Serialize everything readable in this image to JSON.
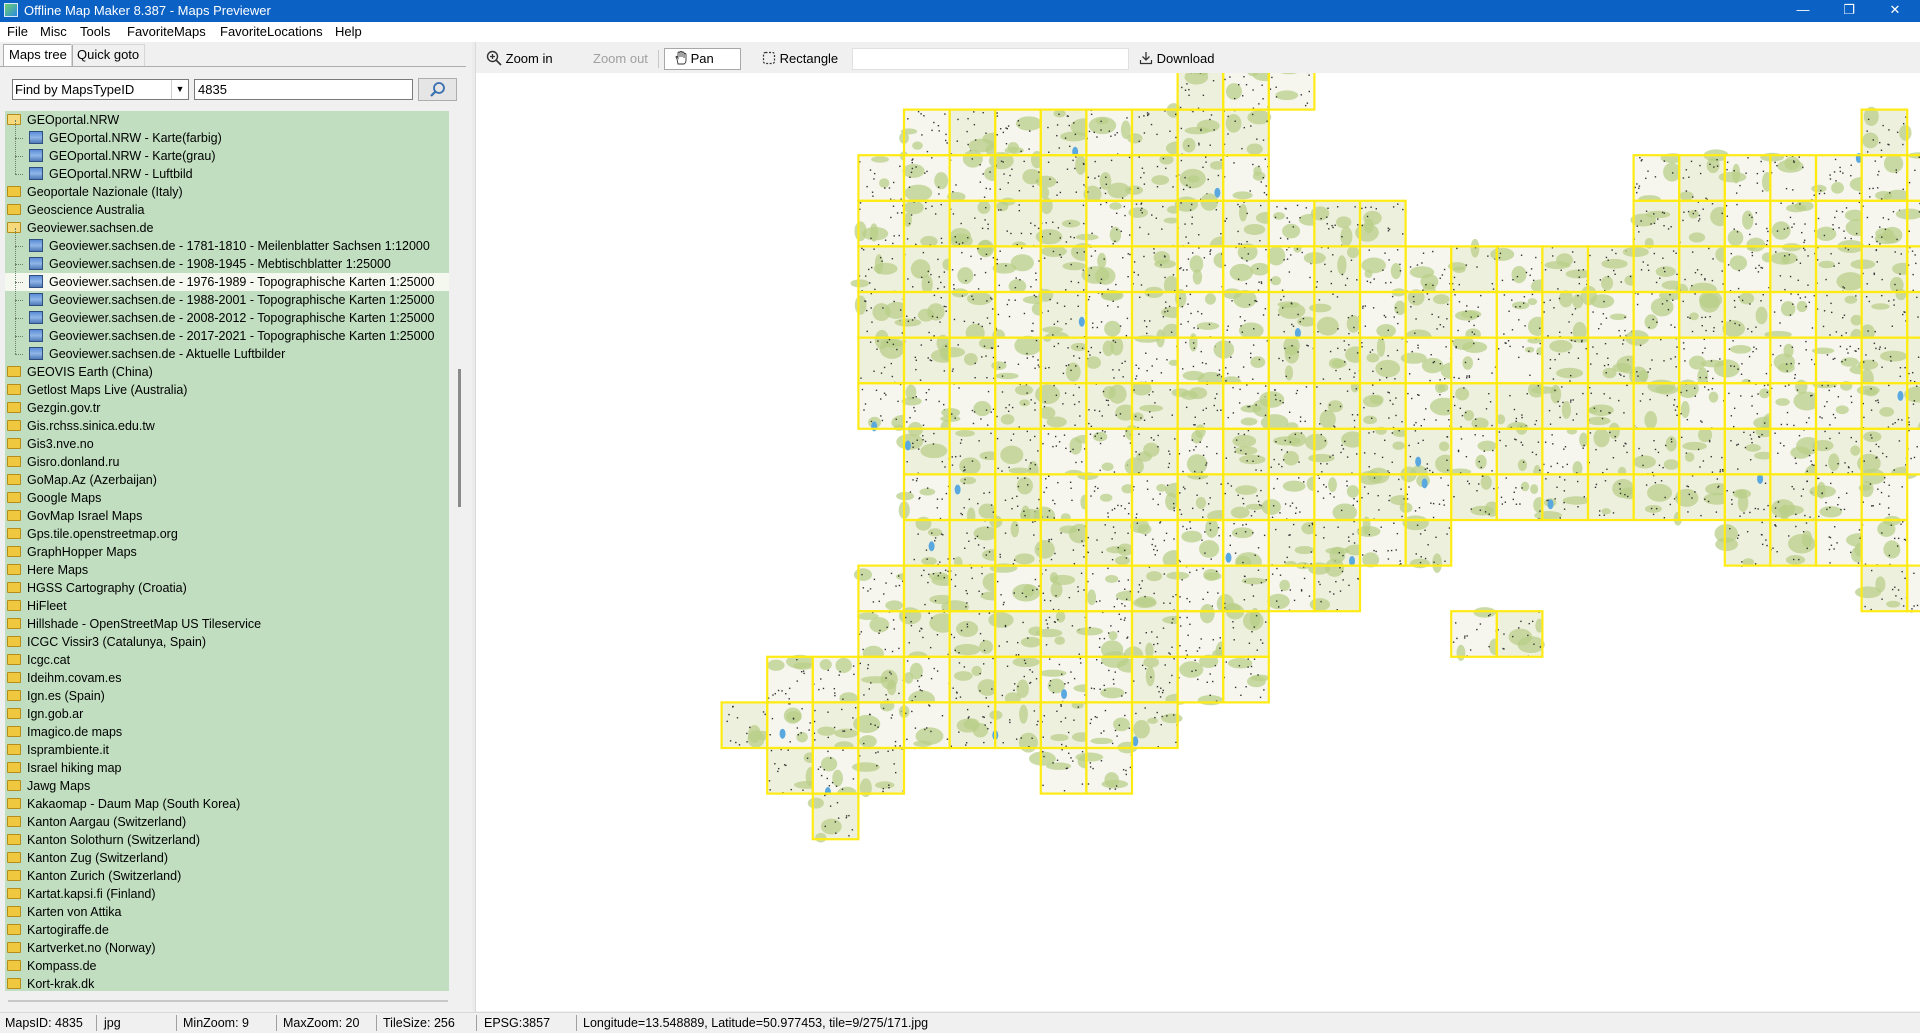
{
  "window": {
    "title": "Offline Map Maker 8.387 - Maps Previewer",
    "minimize": "—",
    "maximize": "❐",
    "close": "✕"
  },
  "menu": [
    "File",
    "Misc",
    "Tools",
    "FavoriteMaps",
    "FavoriteLocations",
    "Help"
  ],
  "tabs": {
    "maps_tree": "Maps tree",
    "quick_goto": "Quick goto"
  },
  "search": {
    "mode": "Find by MapsTypeID",
    "value": "4835"
  },
  "tree": [
    {
      "label": "GEOportal.NRW",
      "type": "folder-open",
      "depth": 0
    },
    {
      "label": "GEOportal.NRW - Karte(farbig)",
      "type": "map",
      "depth": 1
    },
    {
      "label": "GEOportal.NRW - Karte(grau)",
      "type": "map",
      "depth": 1
    },
    {
      "label": "GEOportal.NRW - Luftbild",
      "type": "map",
      "depth": 1
    },
    {
      "label": "Geoportale Nazionale (Italy)",
      "type": "folder",
      "depth": 0
    },
    {
      "label": "Geoscience Australia",
      "type": "folder",
      "depth": 0
    },
    {
      "label": "Geoviewer.sachsen.de",
      "type": "folder-open",
      "depth": 0
    },
    {
      "label": "Geoviewer.sachsen.de - 1781-1810 - Meilenblatter Sachsen 1:12000",
      "type": "map",
      "depth": 1
    },
    {
      "label": "Geoviewer.sachsen.de - 1908-1945 - Mebtischblatter 1:25000",
      "type": "map",
      "depth": 1
    },
    {
      "label": "Geoviewer.sachsen.de - 1976-1989 - Topographische Karten 1:25000",
      "type": "map",
      "depth": 1,
      "selected": true
    },
    {
      "label": "Geoviewer.sachsen.de - 1988-2001 - Topographische Karten 1:25000",
      "type": "map",
      "depth": 1
    },
    {
      "label": "Geoviewer.sachsen.de - 2008-2012 - Topographische Karten 1:25000",
      "type": "map",
      "depth": 1
    },
    {
      "label": "Geoviewer.sachsen.de - 2017-2021 - Topographische Karten 1:25000",
      "type": "map",
      "depth": 1
    },
    {
      "label": "Geoviewer.sachsen.de - Aktuelle Luftbilder",
      "type": "map",
      "depth": 1
    },
    {
      "label": "GEOVIS Earth (China)",
      "type": "folder",
      "depth": 0
    },
    {
      "label": "Getlost Maps Live (Australia)",
      "type": "folder",
      "depth": 0
    },
    {
      "label": "Gezgin.gov.tr",
      "type": "folder",
      "depth": 0
    },
    {
      "label": "Gis.rchss.sinica.edu.tw",
      "type": "folder",
      "depth": 0
    },
    {
      "label": "Gis3.nve.no",
      "type": "folder",
      "depth": 0
    },
    {
      "label": "Gisro.donland.ru",
      "type": "folder",
      "depth": 0
    },
    {
      "label": "GoMap.Az (Azerbaijan)",
      "type": "folder",
      "depth": 0
    },
    {
      "label": "Google Maps",
      "type": "folder",
      "depth": 0
    },
    {
      "label": "GovMap Israel Maps",
      "type": "folder",
      "depth": 0
    },
    {
      "label": "Gps.tile.openstreetmap.org",
      "type": "folder",
      "depth": 0
    },
    {
      "label": "GraphHopper Maps",
      "type": "folder",
      "depth": 0
    },
    {
      "label": "Here Maps",
      "type": "folder",
      "depth": 0
    },
    {
      "label": "HGSS Cartography (Croatia)",
      "type": "folder",
      "depth": 0
    },
    {
      "label": "HiFleet",
      "type": "folder",
      "depth": 0
    },
    {
      "label": "Hillshade - OpenStreetMap US Tileservice",
      "type": "folder",
      "depth": 0
    },
    {
      "label": "ICGC Vissir3 (Catalunya, Spain)",
      "type": "folder",
      "depth": 0
    },
    {
      "label": "Icgc.cat",
      "type": "folder",
      "depth": 0
    },
    {
      "label": "Ideihm.covam.es",
      "type": "folder",
      "depth": 0
    },
    {
      "label": "Ign.es (Spain)",
      "type": "folder",
      "depth": 0
    },
    {
      "label": "Ign.gob.ar",
      "type": "folder",
      "depth": 0
    },
    {
      "label": "Imagico.de maps",
      "type": "folder",
      "depth": 0
    },
    {
      "label": "Isprambiente.it",
      "type": "folder",
      "depth": 0
    },
    {
      "label": "Israel hiking map",
      "type": "folder",
      "depth": 0
    },
    {
      "label": "Jawg Maps",
      "type": "folder",
      "depth": 0
    },
    {
      "label": "Kakaomap - Daum Map (South Korea)",
      "type": "folder",
      "depth": 0
    },
    {
      "label": "Kanton Aargau (Switzerland)",
      "type": "folder",
      "depth": 0
    },
    {
      "label": "Kanton Solothurn (Switzerland)",
      "type": "folder",
      "depth": 0
    },
    {
      "label": "Kanton Zug (Switzerland)",
      "type": "folder",
      "depth": 0
    },
    {
      "label": "Kanton Zurich (Switzerland)",
      "type": "folder",
      "depth": 0
    },
    {
      "label": "Kartat.kapsi.fi (Finland)",
      "type": "folder",
      "depth": 0
    },
    {
      "label": "Karten von Attika",
      "type": "folder",
      "depth": 0
    },
    {
      "label": "Kartogiraffe.de",
      "type": "folder",
      "depth": 0
    },
    {
      "label": "Kartverket.no (Norway)",
      "type": "folder",
      "depth": 0
    },
    {
      "label": "Kompass.de",
      "type": "folder",
      "depth": 0
    },
    {
      "label": "Kort-krak.dk",
      "type": "folder",
      "depth": 0
    }
  ],
  "toolbar": {
    "zoom_in": "Zoom in",
    "zoom_out": "Zoom out",
    "pan_map": "Pan map",
    "rectangle": "Rectangle",
    "download": "Download"
  },
  "status": {
    "maps_id": "MapsID: 4835",
    "format": "jpg",
    "min_zoom": "MinZoom: 9",
    "max_zoom": "MaxZoom: 20",
    "tile_size": "TileSize: 256",
    "epsg": "EPSG:3857",
    "position": "Longitude=13.548889, Latitude=50.977453, tile=9/275/171.jpg"
  },
  "colors": {
    "titlebar": "#0b62c4",
    "tree_background": "#c1dec0",
    "tile_border": "#ffeb14",
    "map_green": "#b9cf8a",
    "map_water": "#5aa8e0"
  }
}
